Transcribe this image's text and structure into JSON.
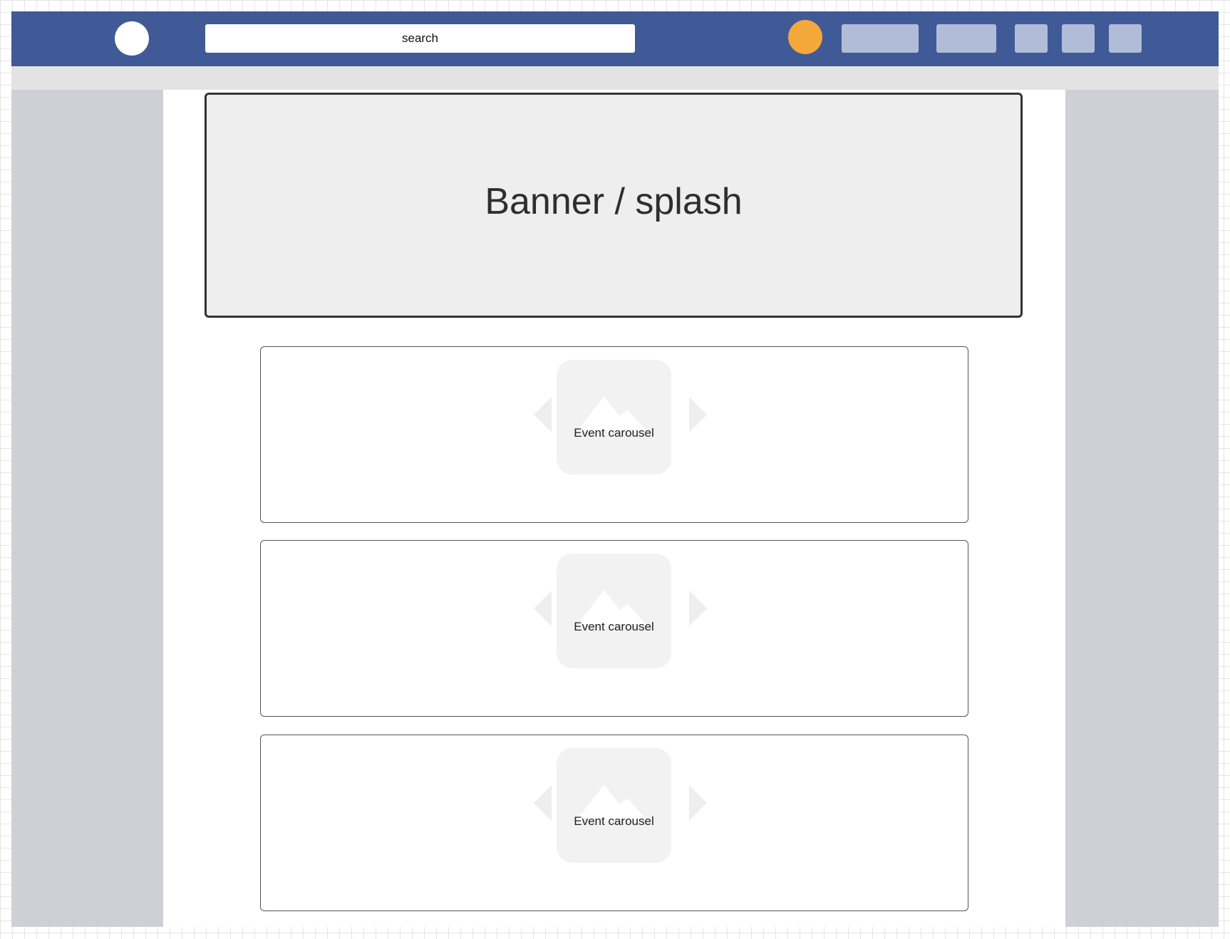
{
  "header": {
    "search_placeholder": "search"
  },
  "banner": {
    "title": "Banner / splash"
  },
  "carousels": [
    {
      "label": "Event carousel"
    },
    {
      "label": "Event carousel"
    },
    {
      "label": "Event carousel"
    }
  ],
  "colors": {
    "topbar": "#3f5a96",
    "avatar": "#f4a83a",
    "nav_button": "#b1bdd8",
    "sidebar": "#cdd0d5"
  },
  "icons": {
    "logo": "logo-circle-icon",
    "avatar": "user-avatar-icon",
    "carousel_image": "image-placeholder-icon",
    "prev": "chevron-left-icon",
    "next": "chevron-right-icon"
  }
}
